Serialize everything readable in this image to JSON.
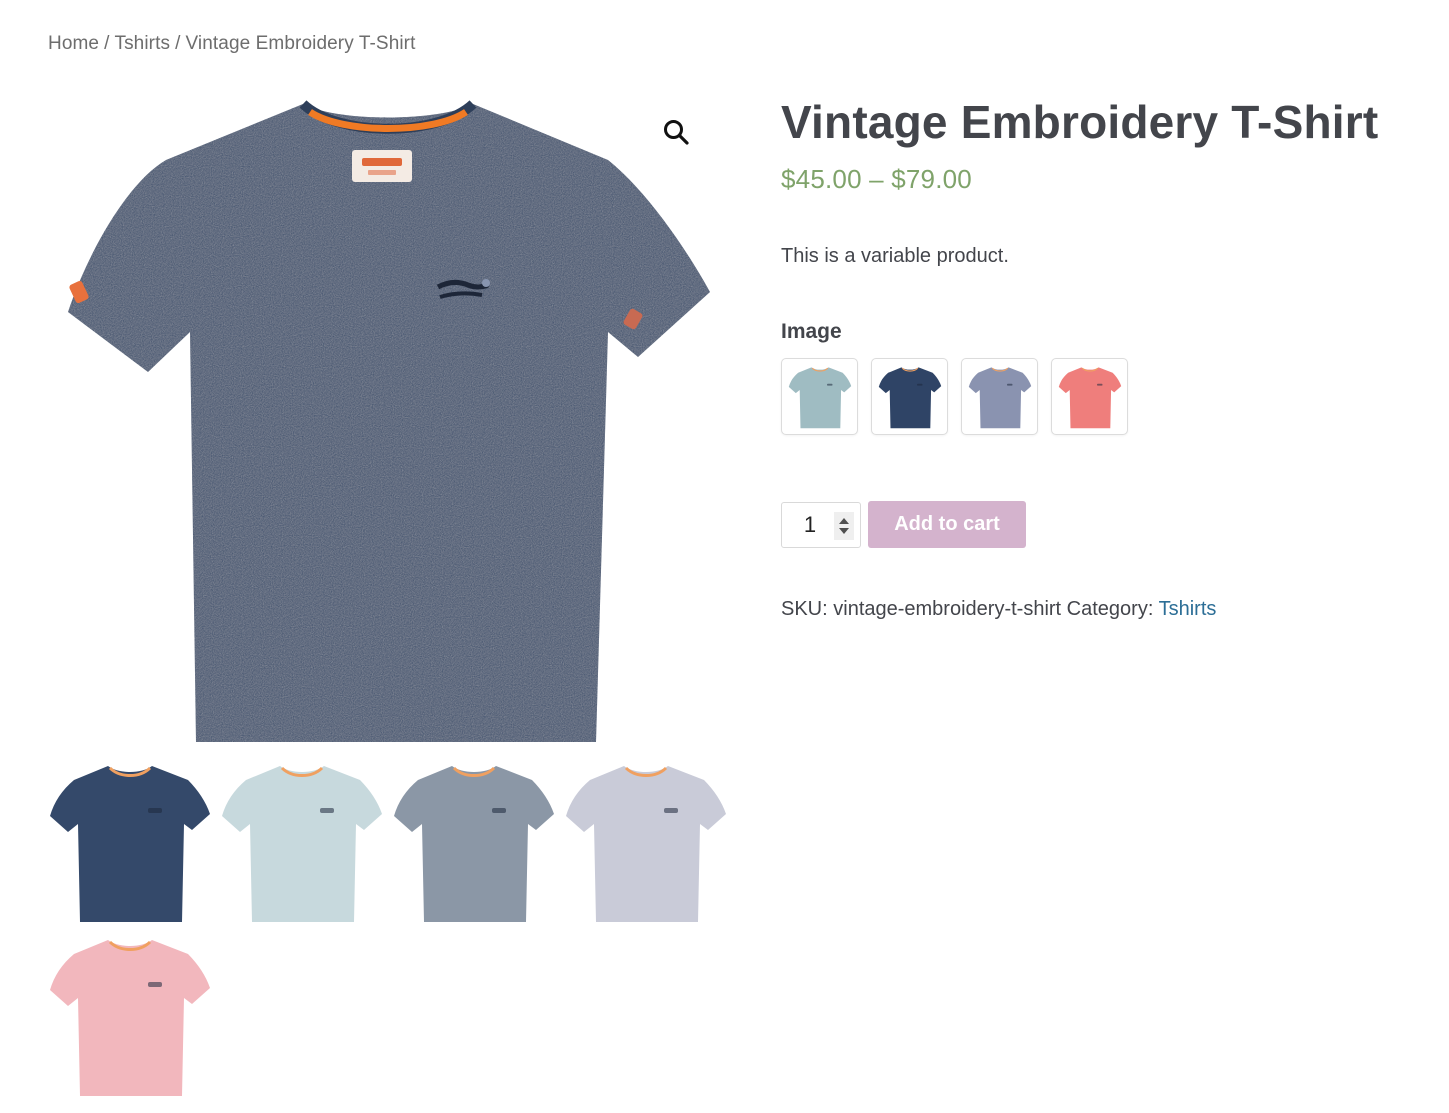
{
  "breadcrumb": {
    "items": [
      "Home",
      "Tshirts",
      "Vintage Embroidery T-Shirt"
    ],
    "separator": "/"
  },
  "gallery": {
    "main_image": {
      "alt": "Navy marl t-shirt",
      "color": "#3a4d6b"
    },
    "zoom_icon": "search-icon",
    "thumbnails": [
      {
        "alt": "Navy t-shirt",
        "color": "#34496a"
      },
      {
        "alt": "Light blue t-shirt",
        "color": "#c7d9dd"
      },
      {
        "alt": "Grey blue t-shirt",
        "color": "#8b97a6"
      },
      {
        "alt": "Light grey t-shirt",
        "color": "#c9cbd8"
      },
      {
        "alt": "Pink t-shirt",
        "color": "#f2b7bd"
      }
    ]
  },
  "product": {
    "title": "Vintage Embroidery T-Shirt",
    "price": "$45.00 – $79.00",
    "price_color": "#7fa36a",
    "description": "This is a variable product.",
    "attribute_label": "Image",
    "swatches": [
      {
        "alt": "Light blue",
        "color": "#9fbcc2"
      },
      {
        "alt": "Navy",
        "color": "#2f4466"
      },
      {
        "alt": "Grey blue",
        "color": "#8a93b0"
      },
      {
        "alt": "Coral",
        "color": "#ef7e7c"
      }
    ],
    "quantity": "1",
    "add_to_cart": "Add to cart",
    "button_color": "#d4b3cd",
    "sku_label": "SKU:",
    "sku": "vintage-embroidery-t-shirt",
    "category_label": "Category:",
    "category": "Tshirts",
    "link_color": "#2c6e96"
  }
}
